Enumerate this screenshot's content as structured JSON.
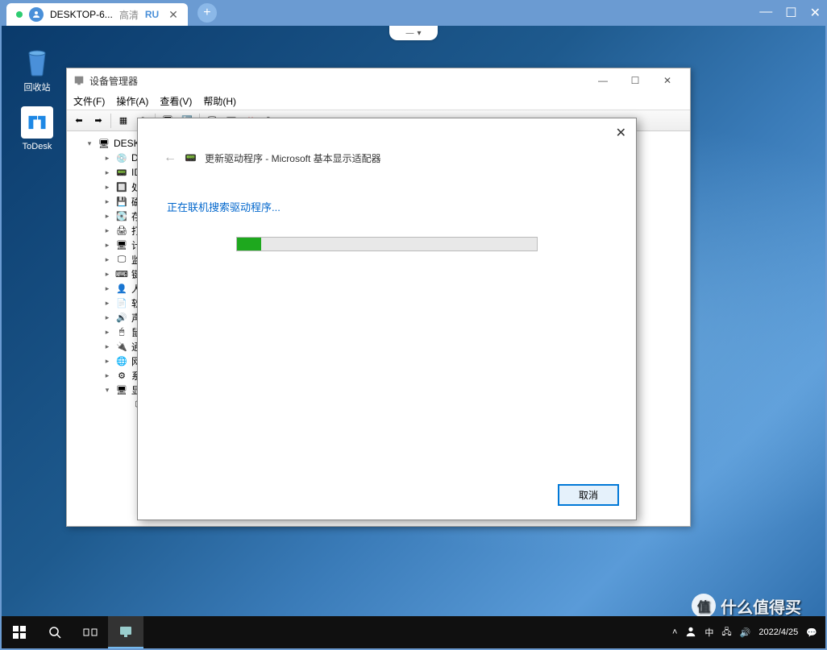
{
  "remote": {
    "tab_title": "DESKTOP-6...",
    "quality": "高清",
    "lang": "RU"
  },
  "desktop_icons": {
    "recycle": "回收站",
    "todesk": "ToDesk"
  },
  "devmgr": {
    "title": "设备管理器",
    "menu": {
      "file": "文件(F)",
      "action": "操作(A)",
      "view": "查看(V)",
      "help": "帮助(H)"
    },
    "tree": {
      "root": "DESKT",
      "items": [
        "DV",
        "IDE",
        "处理",
        "磁盘",
        "存储",
        "打印",
        "计算",
        "监视",
        "键盘",
        "人体",
        "软件",
        "声音",
        "鼠标",
        "通用",
        "网络",
        "系统",
        "显示"
      ]
    }
  },
  "dialog": {
    "title": "更新驱动程序 - Microsoft 基本显示适配器",
    "status": "正在联机搜索驱动程序...",
    "cancel": "取消"
  },
  "tray": {
    "ime": "中",
    "date": "2022/4/25"
  },
  "watermark": "什么值得买"
}
